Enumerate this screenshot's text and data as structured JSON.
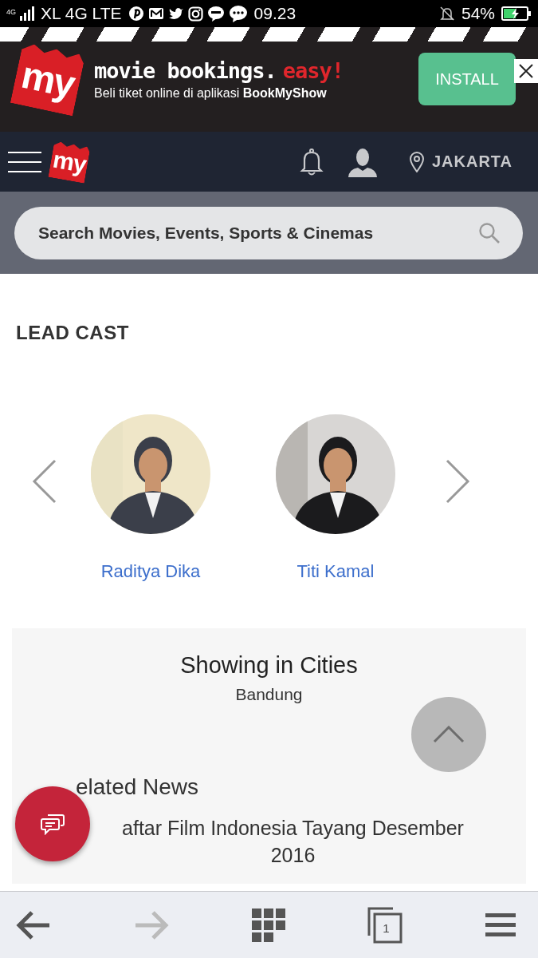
{
  "status_bar": {
    "network_badge": "4G",
    "carrier": "XL 4G LTE",
    "time": "09.23",
    "battery": "54%",
    "charging": true
  },
  "ad_banner": {
    "logo": "my",
    "headline": "movie bookings.",
    "headline_accent": "easy!",
    "subtitle": "Beli tiket online di aplikasi **BookMyShow**",
    "install_button": "INSTALL"
  },
  "nav": {
    "logo": "my",
    "city": "JAKARTA"
  },
  "search": {
    "placeholder": "Search Movies, Events, Sports & Cinemas"
  },
  "lead_cast": {
    "title": "LEAD CAST",
    "cast": [
      {
        "name": "Raditya Dika"
      },
      {
        "name": "Titi Kamal"
      }
    ]
  },
  "showing": {
    "title": "Showing in Cities",
    "cities": [
      "Bandung"
    ]
  },
  "related_news": {
    "title": "elated News",
    "items": [
      "aftar Film Indonesia Tayang Desember 2016"
    ]
  },
  "browser_toolbar": {
    "back_disabled": false,
    "forward_disabled": true,
    "tab_count": "1"
  }
}
